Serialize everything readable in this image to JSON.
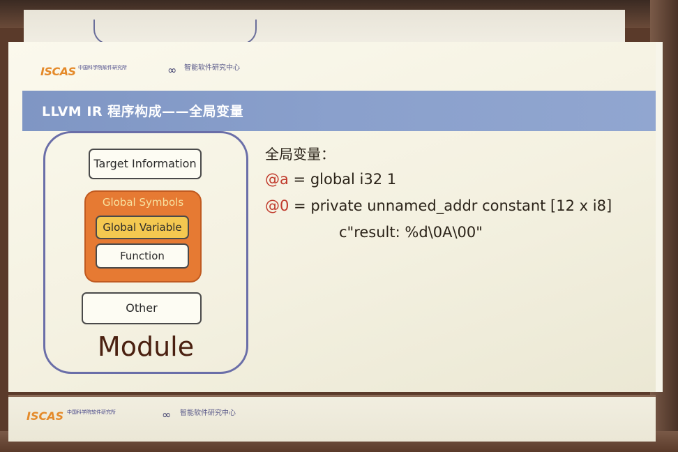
{
  "slide": {
    "title": "LLVM IR 程序构成——全局变量",
    "logos": {
      "iscas": "ISCAS",
      "iscas_sub": "中国科学院软件研究所",
      "isrc_icon": "isrc-logo-icon",
      "isrc_text": "智能软件研究中心"
    }
  },
  "diagram": {
    "target_information": "Target Information",
    "global_symbols": "Global Symbols",
    "global_variable": "Global Variable",
    "function": "Function",
    "other": "Other",
    "module": "Module",
    "colors": {
      "global_symbols_fill": "#e67a33",
      "global_variable_fill": "#f4c850",
      "module_border": "#6a6ea8"
    }
  },
  "code": {
    "heading": "全局变量：",
    "line1_sym": "@a",
    "line1_rest": " = global i32 1",
    "line2_sym": "@0",
    "line2_rest": " = private unnamed_addr constant [12 x i8]",
    "line3": "c\"result: %d\\0A\\00\"",
    "symbol_color": "#c0392b"
  }
}
